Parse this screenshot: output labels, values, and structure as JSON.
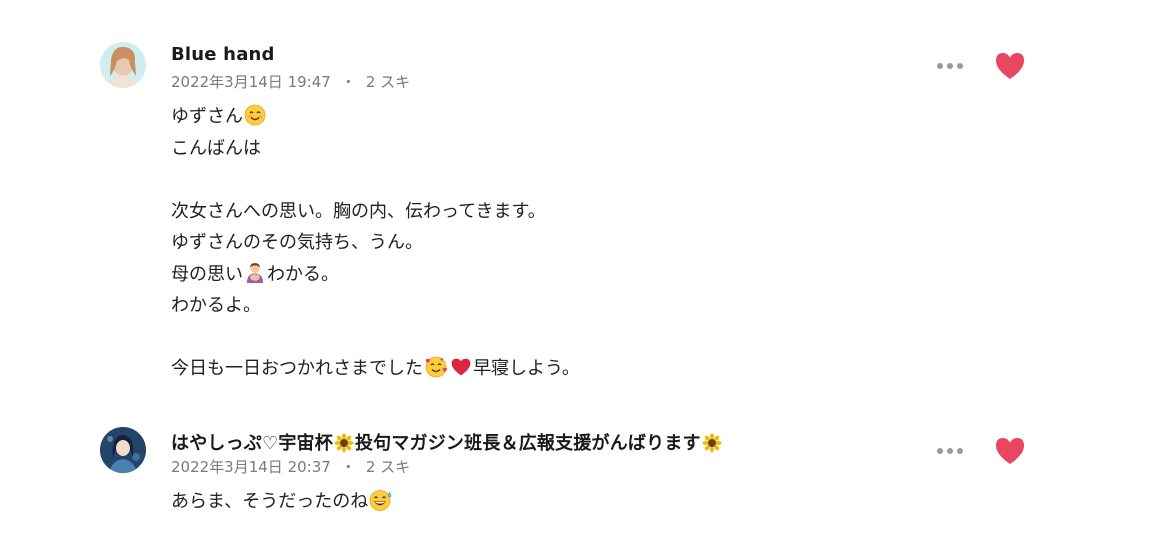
{
  "comments": [
    {
      "author": "Blue hand",
      "date": "2022年3月14日 19:47",
      "separator": "・",
      "likes": "2 スキ",
      "lines": [
        [
          "ゆずさん",
          "smiling-face-emoji"
        ],
        [
          "こんばんは"
        ],
        [
          ""
        ],
        [
          "次女さんへの思い。胸の内、伝わってきます。"
        ],
        [
          "ゆずさんのその気持ち、うん。"
        ],
        [
          "母の思い",
          "woman-with-baby-emoji",
          "わかる。"
        ],
        [
          "わかるよ。"
        ],
        [
          ""
        ],
        [
          "今日も一日おつかれさまでした",
          "smiling-face-with-hearts-emoji",
          "red-heart-emoji",
          "早寝しよう。"
        ]
      ],
      "liked": true
    },
    {
      "author": "はやしっぷ♡宇宙杯",
      "author_mid": "投句マガジン班長＆広報支援がんばります",
      "author_emoji": "sunflower-emoji",
      "date": "2022年3月14日 20:37",
      "separator": "・",
      "likes": "2 スキ",
      "text": "あらま、そうだったのね",
      "text_emoji": "grinning-face-with-sweat-emoji",
      "liked": true
    }
  ],
  "colors": {
    "heart": "#e8475f",
    "meta": "#7a7a7a",
    "dots": "#9a9a9a"
  },
  "icons": {
    "more": "more-dots-icon",
    "like": "heart-icon"
  }
}
